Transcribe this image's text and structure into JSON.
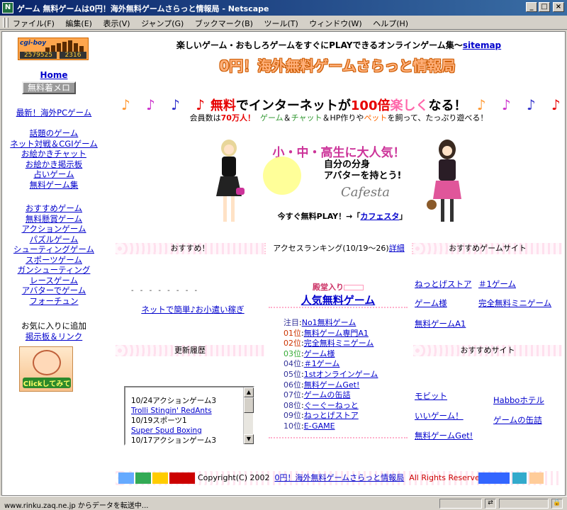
{
  "window": {
    "title": "ゲーム 無料ゲームは0円！海外無料ゲームさらっと情報局 - Netscape",
    "app_icon": "N"
  },
  "menu": [
    "ファイル(F)",
    "編集(E)",
    "表示(V)",
    "ジャンプ(G)",
    "ブックマーク(B)",
    "ツール(T)",
    "ウィンドウ(W)",
    "ヘルプ(H)"
  ],
  "counter": {
    "logo": "cgi-boy",
    "total": "2579525",
    "today": "2316"
  },
  "sidebar": {
    "home": "Home",
    "button": "無料着メロ",
    "group1": [
      "最新！海外PCゲーム"
    ],
    "group2": [
      "話題のゲーム",
      "ネット対戦＆CGIゲーム",
      "お絵かきチャット",
      "お絵かき掲示板",
      "占いゲーム",
      "無料ゲーム集"
    ],
    "group3": [
      "おすすめゲーム",
      "無料懸賞ゲーム",
      "アクションゲーム",
      "パズルゲーム",
      "シューティングゲーム",
      "スポーツゲーム",
      "ガンシューティング",
      "レースゲーム",
      "アバターでゲーム",
      "フォーチュン"
    ],
    "bookmark": "お気に入りに追加",
    "board": "掲示板＆リンク",
    "banner": "Clickしてみて"
  },
  "header": {
    "tagline": "楽しいゲーム・おもしろゲームをすぐにPLAYできるオンラインゲーム集〜",
    "sitemap": "sitemap",
    "site_title": "0円！海外無料ゲームさらっと情報局"
  },
  "promo": {
    "free": "無料",
    "mid": "でインターネットが",
    "hundred": "100倍",
    "fun": "楽しく",
    "end": "なる！",
    "members_pre": "会員数は",
    "members": "70万人！",
    "game": "ゲーム",
    "amp1": "＆",
    "chat": "チャット",
    "amp2": "＆HP作りや",
    "pet": "ペット",
    "rest": "を飼って、たっぷり遊べる！"
  },
  "cafesta": {
    "headline": "小・中・高生に大人気！",
    "catch1": "自分の分身",
    "catch2": "アバターを持とう!",
    "brand": "Cafesta",
    "cta": "今すぐ無料PLAY！→「",
    "cta_link": "カフェスタ",
    "cta_end": "」"
  },
  "bands": {
    "recommend": "おすすめ！",
    "ranking": "アクセスランキング(10/19〜26)",
    "ranking_more": "詳細",
    "rec_sites": "おすすめゲームサイト",
    "history": "更新履歴",
    "rec_site2": "おすすめサイト"
  },
  "recommend": {
    "ticker": "- - -  - -  - - -",
    "money_link": "ネットで簡単♪お小遣い稼ぎ"
  },
  "ranking": {
    "fame_label": "殿堂入り",
    "title": "人気無料ゲーム",
    "items": [
      {
        "pos": "注目",
        "name": "No1無料ゲーム"
      },
      {
        "pos": "01位",
        "name": "無料ゲーム専門A1"
      },
      {
        "pos": "02位",
        "name": "完全無料ミニゲーム"
      },
      {
        "pos": "03位",
        "name": "ゲーム様"
      },
      {
        "pos": "04位",
        "name": "＃1ゲーム"
      },
      {
        "pos": "05位",
        "name": "1stオンラインゲーム"
      },
      {
        "pos": "06位",
        "name": "無料ゲームGet!"
      },
      {
        "pos": "07位",
        "name": "ゲームの缶詰"
      },
      {
        "pos": "08位",
        "name": "ぐーぐーねっと"
      },
      {
        "pos": "09位",
        "name": "ねっとげストア"
      },
      {
        "pos": "10位",
        "name": "E-GAME"
      }
    ]
  },
  "rec_sites": {
    "col1": [
      "ねっとげストア",
      "ゲーム様",
      "無料ゲームA1"
    ],
    "col2": [
      "＃1ゲーム",
      "完全無料ミニゲーム"
    ]
  },
  "rec_sites2": {
    "col1": [
      "モビット",
      "いいゲーム！",
      "無料ゲームGet!"
    ],
    "col2": [
      "Habboホテル",
      "ゲームの缶詰"
    ]
  },
  "history": [
    {
      "text": "10/24アクションゲーム3",
      "link": false
    },
    {
      "text": "Trolli Stingin' RedAnts",
      "link": true
    },
    {
      "text": "10/19スポーツ1",
      "link": false
    },
    {
      "text": "Super Spud Boxing",
      "link": true
    },
    {
      "text": "10/17アクションゲーム3",
      "link": false
    }
  ],
  "footer": {
    "copy": "Copyright(C) 2002",
    "site": "0円！海外無料ゲームさらっと情報局",
    "rights": "All Rights Reserved"
  },
  "status": {
    "message": "www.rinku.zaq.ne.jp からデータを転送中..."
  },
  "colors": {
    "title_bar": "#0a246a",
    "link": "#0000cc",
    "accent_red": "#e60000",
    "logo_orange": "#ffb07a"
  }
}
